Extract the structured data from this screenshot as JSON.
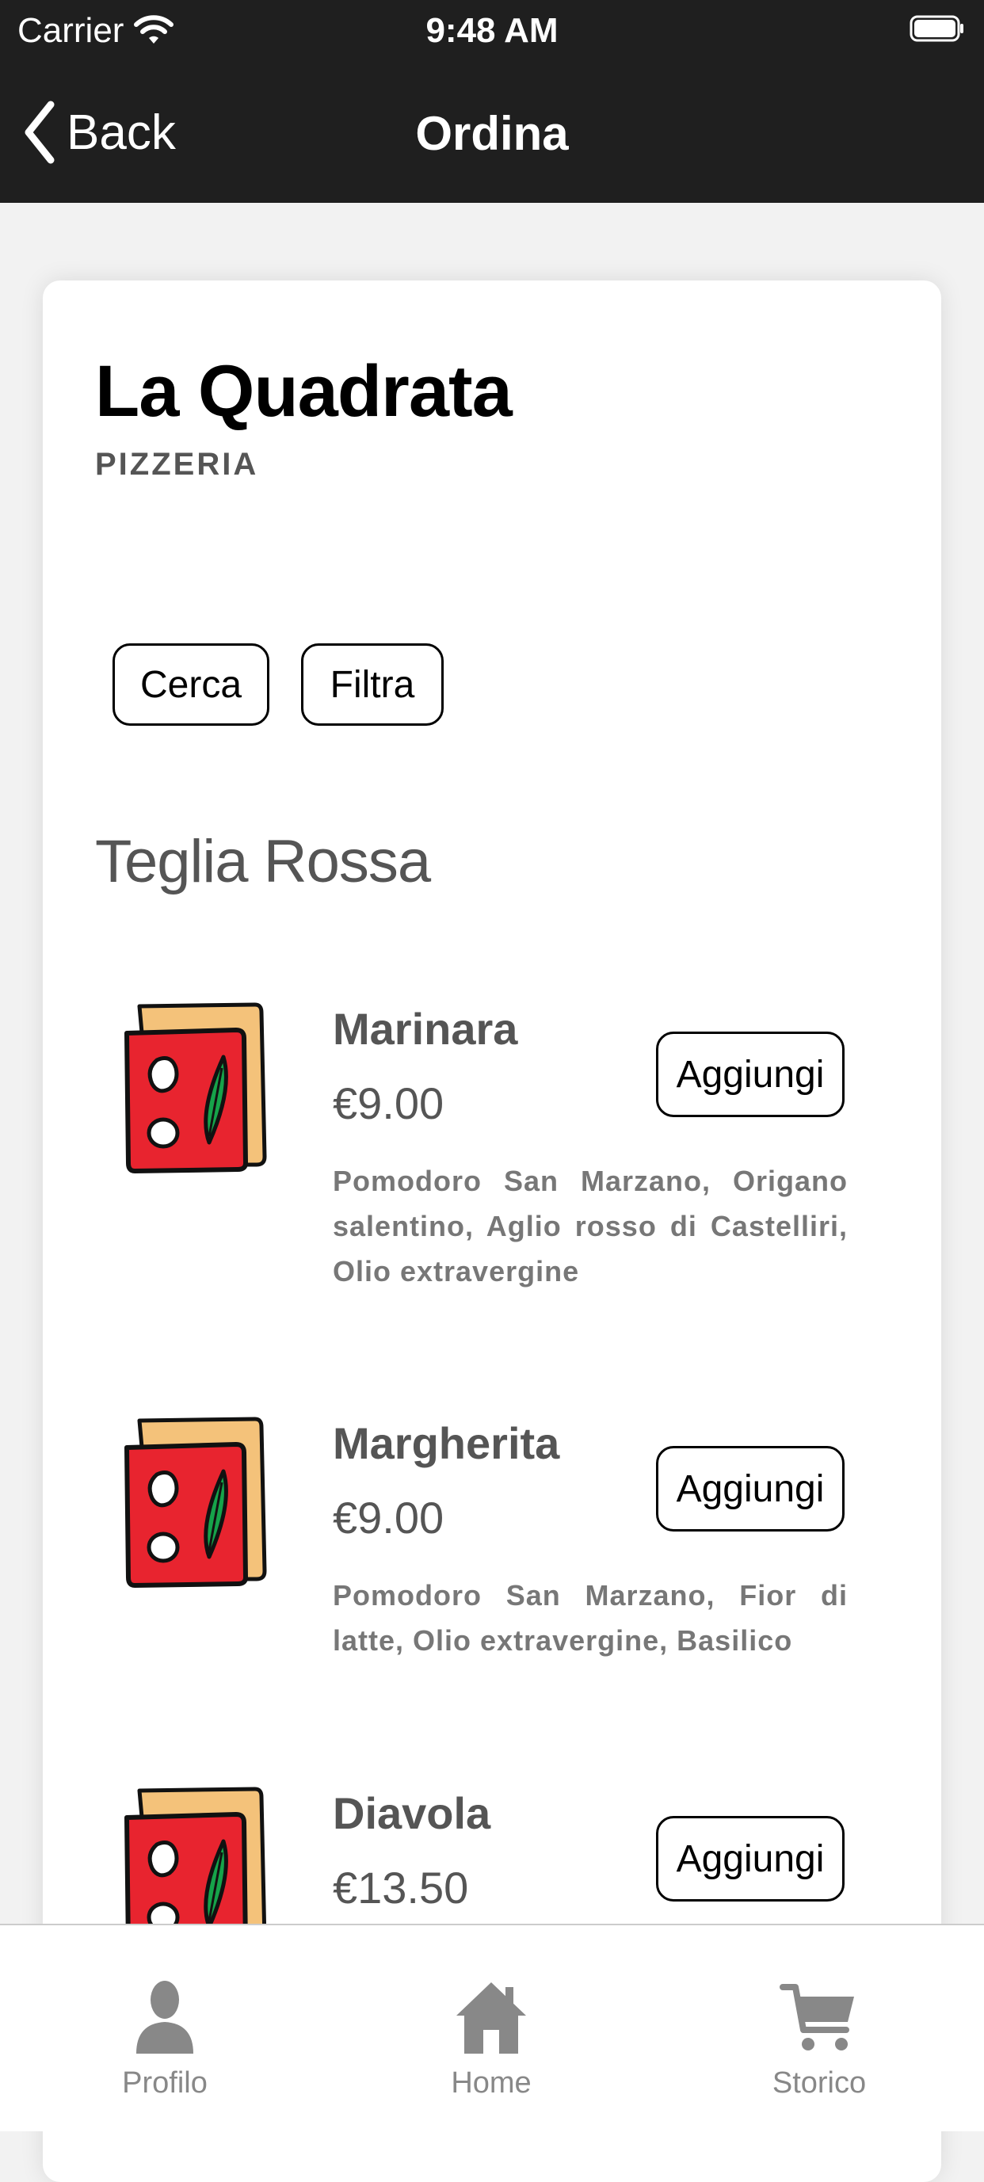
{
  "status_bar": {
    "carrier": "Carrier",
    "time": "9:48 AM"
  },
  "nav": {
    "back_label": "Back",
    "title": "Ordina"
  },
  "restaurant": {
    "name": "La Quadrata",
    "type": "PIZZERIA"
  },
  "actions": {
    "search": "Cerca",
    "filter": "Filtra"
  },
  "section": {
    "title": "Teglia Rossa"
  },
  "items": [
    {
      "name": "Marinara",
      "price": "€9.00",
      "description": "Pomodoro San Marzano, Origano salentino, Aglio rosso di Castelliri, Olio extravergine",
      "add_label": "Aggiungi"
    },
    {
      "name": "Margherita",
      "price": "€9.00",
      "description": "Pomodoro San Marzano, Fior di latte, Olio extravergine, Basilico",
      "add_label": "Aggiungi"
    },
    {
      "name": "Diavola",
      "price": "€13.50",
      "description": "",
      "add_label": "Aggiungi"
    }
  ],
  "tabbar": {
    "tabs": [
      {
        "label": "Profilo",
        "icon": "person-icon"
      },
      {
        "label": "Home",
        "icon": "home-icon"
      },
      {
        "label": "Storico",
        "icon": "cart-icon"
      }
    ]
  },
  "colors": {
    "header_bg": "#1f1f1f",
    "pizza_red": "#e8242f",
    "pizza_crust": "#f4c27a",
    "basil_green": "#16a34a"
  }
}
